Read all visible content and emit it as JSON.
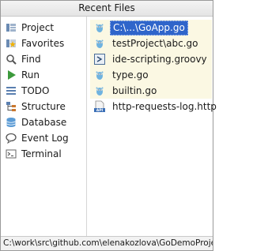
{
  "window": {
    "title": "Recent Files"
  },
  "sidebar": {
    "items": [
      {
        "label": "Project",
        "icon": "project-icon"
      },
      {
        "label": "Favorites",
        "icon": "favorites-icon"
      },
      {
        "label": "Find",
        "icon": "find-icon"
      },
      {
        "label": "Run",
        "icon": "run-icon"
      },
      {
        "label": "TODO",
        "icon": "todo-icon"
      },
      {
        "label": "Structure",
        "icon": "structure-icon"
      },
      {
        "label": "Database",
        "icon": "database-icon"
      },
      {
        "label": "Event Log",
        "icon": "event-log-icon"
      },
      {
        "label": "Terminal",
        "icon": "terminal-icon"
      }
    ]
  },
  "files": {
    "items": [
      {
        "label": "C:\\...\\GoApp.go",
        "icon": "go-file-icon",
        "selected": true
      },
      {
        "label": "testProject\\abc.go",
        "icon": "go-file-icon",
        "selected": false
      },
      {
        "label": "ide-scripting.groovy",
        "icon": "groovy-file-icon",
        "selected": false
      },
      {
        "label": "type.go",
        "icon": "go-file-icon",
        "selected": false
      },
      {
        "label": "builtin.go",
        "icon": "go-file-icon",
        "selected": false
      },
      {
        "label": "http-requests-log.http",
        "icon": "api-file-icon",
        "selected": false
      }
    ]
  },
  "status": {
    "path": "C:\\work\\src\\github.com\\elenakozlova\\GoDemoProject"
  },
  "colors": {
    "selection": "#2f65ca",
    "tinted_row": "#fbf8e3"
  }
}
